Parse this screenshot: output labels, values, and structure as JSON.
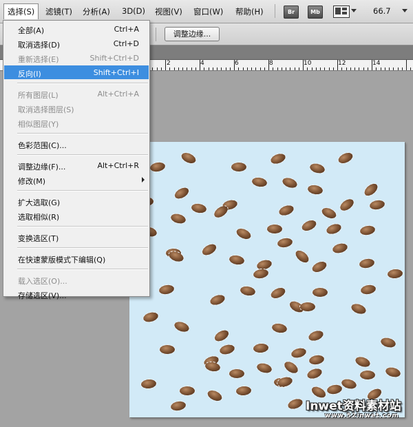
{
  "menubar": {
    "items": [
      {
        "label": "选择(S)",
        "active": true
      },
      {
        "label": "滤镜(T)"
      },
      {
        "label": "分析(A)"
      },
      {
        "label": "3D(D)"
      },
      {
        "label": "视图(V)"
      },
      {
        "label": "窗口(W)"
      },
      {
        "label": "帮助(H)"
      }
    ],
    "bridge_label": "Br",
    "minibridge_label": "Mb",
    "zoom_value": "66.7",
    "icons": [
      "bridge-icon",
      "mini-bridge-icon",
      "arrange-documents-icon",
      "zoom-dropdown-icon"
    ]
  },
  "options_bar": {
    "refine_edge_label": "调整边缘..."
  },
  "ruler": {
    "labels": [
      "2",
      "4",
      "6",
      "8",
      "10",
      "12",
      "14"
    ]
  },
  "select_menu": {
    "groups": [
      [
        {
          "label": "全部(A)",
          "shortcut": "Ctrl+A",
          "enabled": true
        },
        {
          "label": "取消选择(D)",
          "shortcut": "Ctrl+D",
          "enabled": true
        },
        {
          "label": "重新选择(E)",
          "shortcut": "Shift+Ctrl+D",
          "enabled": false
        },
        {
          "label": "反向(I)",
          "shortcut": "Shift+Ctrl+I",
          "enabled": true,
          "highlighted": true
        }
      ],
      [
        {
          "label": "所有图层(L)",
          "shortcut": "Alt+Ctrl+A",
          "enabled": false
        },
        {
          "label": "取消选择图层(S)",
          "shortcut": "",
          "enabled": false
        },
        {
          "label": "相似图层(Y)",
          "shortcut": "",
          "enabled": false
        }
      ],
      [
        {
          "label": "色彩范围(C)...",
          "shortcut": "",
          "enabled": true
        }
      ],
      [
        {
          "label": "调整边缘(F)...",
          "shortcut": "Alt+Ctrl+R",
          "enabled": true
        },
        {
          "label": "修改(M)",
          "shortcut": "",
          "enabled": true,
          "submenu": true
        }
      ],
      [
        {
          "label": "扩大选取(G)",
          "shortcut": "",
          "enabled": true
        },
        {
          "label": "选取相似(R)",
          "shortcut": "",
          "enabled": true
        }
      ],
      [
        {
          "label": "变换选区(T)",
          "shortcut": "",
          "enabled": true
        }
      ],
      [
        {
          "label": "在快速蒙版模式下编辑(Q)",
          "shortcut": "",
          "enabled": true
        }
      ],
      [
        {
          "label": "载入选区(O)...",
          "shortcut": "",
          "enabled": false
        },
        {
          "label": "存储选区(V)...",
          "shortcut": "",
          "enabled": true
        }
      ]
    ]
  },
  "canvas": {
    "background_color": "#d2eaf7",
    "seed_color": "#7c5233"
  },
  "watermark": {
    "title": "Inwet资料素材站",
    "url": "www.52inwet.com"
  }
}
